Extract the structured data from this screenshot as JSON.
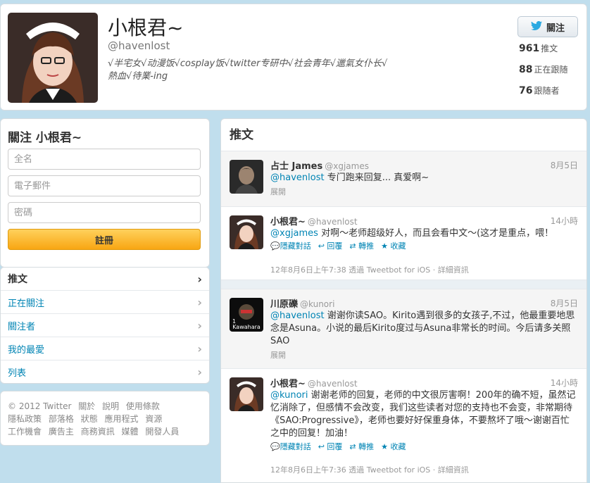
{
  "profile": {
    "name": "小根君~",
    "handle": "@havenlost",
    "bio_line1": "√半宅女√动漫饭√cosplay饭√twitter专研中√社会青年√邋氣女仆长√",
    "bio_line2": "熱血√待業-ing",
    "follow_label": "關注",
    "stats": [
      {
        "count": "961",
        "label": "推文"
      },
      {
        "count": "88",
        "label": "正在跟随"
      },
      {
        "count": "76",
        "label": "跟随者"
      }
    ]
  },
  "signup": {
    "title": "關注 小根君~",
    "fullname_placeholder": "全名",
    "email_placeholder": "電子郵件",
    "password_placeholder": "密碼",
    "submit_label": "註冊"
  },
  "nav": {
    "items": [
      {
        "label": "推文"
      },
      {
        "label": "正在關注"
      },
      {
        "label": "關注者"
      },
      {
        "label": "我的最愛"
      },
      {
        "label": "列表"
      }
    ]
  },
  "footer": {
    "links": [
      "© 2012 Twitter",
      "關於",
      "說明",
      "使用條款",
      "隱私政策",
      "部落格",
      "狀態",
      "應用程式",
      "資源",
      "工作機會",
      "廣告主",
      "商務資訊",
      "媒體",
      "開發人員"
    ]
  },
  "timeline": {
    "title": "推文",
    "tweets": [
      {
        "name": "占士 James",
        "handle": "@xgjames",
        "time": "8月5日",
        "mention": "@havenlost",
        "text": " 专门跑来回复... 真爱啊~",
        "expand": "展開"
      },
      {
        "name": "小根君~",
        "handle": "@havenlost",
        "time": "14小時",
        "mention": "@xgjames",
        "text": " 对啊～老师超级好人，而且会看中文～(这才是重点，喂！",
        "actions": {
          "hide": "隱藏對話",
          "reply": "回覆",
          "retweet": "轉推",
          "favorite": "收藏"
        },
        "meta": "12年8月6日上午7:38 透過 Tweetbot for iOS · 詳細資訊"
      },
      {
        "name": "川原礫",
        "handle": "@kunori",
        "time": "8月5日",
        "mention": "@havenlost",
        "text": " 谢谢你读SAO。Kirito遇到很多的女孩子,不过，他最重要地思念是Asuna。小说的最后Kirito度过与Asuna非常长的时间。今后请多关照SAO",
        "expand": "展開",
        "avatar_label": "Kawahara"
      },
      {
        "name": "小根君~",
        "handle": "@havenlost",
        "time": "14小時",
        "mention": "@kunori",
        "text": " 谢谢老师的回复，老师的中文很厉害啊！200年的确不短，虽然记忆消除了，但感情不会改变，我们这些读者对您的支持也不会变，非常期待《SAO:Progressive》，老师也要好好保重身体，不要熬坏了哦～谢谢百忙之中的回复！加油！",
        "actions": {
          "hide": "隱藏對話",
          "reply": "回覆",
          "retweet": "轉推",
          "favorite": "收藏"
        },
        "meta": "12年8月6日上午7:36 透過 Tweetbot for iOS · 詳細資訊"
      }
    ]
  },
  "colors": {
    "link": "#0084b4",
    "background": "#c0deed",
    "button_orange": "#f8a613"
  }
}
